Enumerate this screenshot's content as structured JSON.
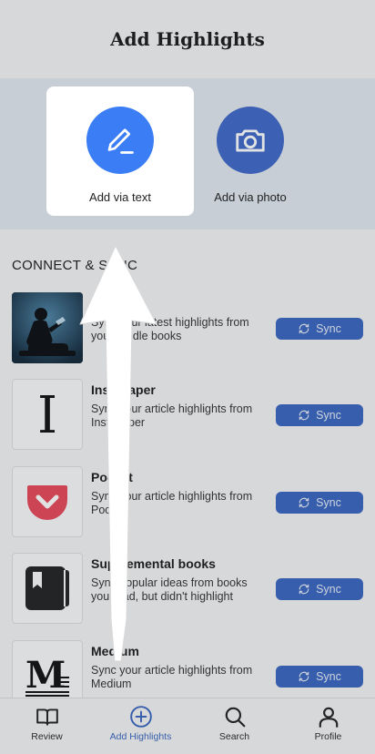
{
  "header": {
    "title": "Add Highlights"
  },
  "add_options": [
    {
      "label": "Add via text",
      "icon": "pencil-icon",
      "selected": true
    },
    {
      "label": "Add via photo",
      "icon": "camera-icon",
      "selected": false
    }
  ],
  "connect": {
    "title": "CONNECT & SYNC",
    "sync_label": "Sync",
    "sources": [
      {
        "name": "Kindle",
        "desc": "Sync your latest highlights from your Kindle books",
        "icon": "kindle-reader-icon"
      },
      {
        "name": "Instapaper",
        "desc": "Sync your article highlights from Instapaper",
        "icon": "instapaper-icon"
      },
      {
        "name": "Pocket",
        "desc": "Sync your article highlights from Pocket",
        "icon": "pocket-icon"
      },
      {
        "name": "Supplemental books",
        "desc": "Sync popular ideas from books you read, but didn't highlight",
        "icon": "book-icon"
      },
      {
        "name": "Medium",
        "desc": "Sync your article highlights from Medium",
        "icon": "medium-icon"
      }
    ]
  },
  "tabs": [
    {
      "label": "Review",
      "icon": "book-open-icon",
      "active": false
    },
    {
      "label": "Add Highlights",
      "icon": "plus-circle-icon",
      "active": true
    },
    {
      "label": "Search",
      "icon": "search-icon",
      "active": false
    },
    {
      "label": "Profile",
      "icon": "user-icon",
      "active": false
    }
  ],
  "colors": {
    "accent": "#3a66bf",
    "text_circle": "#3b7df5",
    "photo_circle": "#3f69c9"
  }
}
